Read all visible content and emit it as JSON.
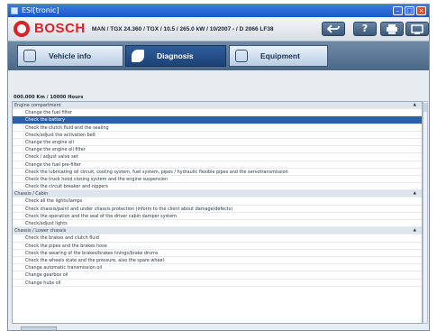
{
  "window": {
    "title": "ESI[tronic]",
    "min_label": "–",
    "max_label": "□",
    "close_label": "×"
  },
  "header": {
    "brand": "BOSCH",
    "vehicle": "MAN / TGX 24.360 / TGX / 10.5 / 265.0 kW / 10/2007 - / D 2066 LF38",
    "help_label": "?"
  },
  "tabs": [
    {
      "label": "Vehicle info"
    },
    {
      "label": "Diagnosis"
    },
    {
      "label": "Equipment"
    }
  ],
  "summary": "000.000 Km / 10000 Hours",
  "list": {
    "cat_engine": "Engine compartment",
    "engine": [
      "Change the fuel filter",
      "Check the battery",
      "Check the clutch fluid and the sealing",
      "Check/adjust the activation belt",
      "Change the engine oil",
      "Change the engine oil filter",
      "Check / adjust valve set",
      "Change the fuel pre-filter",
      "Check the lubricating oil circuit, cooling system, fuel system, pipes / hydraulic flexible pipes and the servotransmission",
      "Check the truck hood closing system and the engine suspension",
      "Check the circuit breaker and nippers"
    ],
    "cat_chassis_cabin": "Chassis / Cabin",
    "chassis_cabin": [
      "Check all the lights/lamps",
      "Check chassis/paint and under chassis protection (inform to the client about damage/defects)",
      "Check the operation and the seal of the driver cabin damper system",
      "Check/adjust lights"
    ],
    "cat_chassis_lower": "Chassis / Lower chassis",
    "chassis_lower": [
      "Check the brakes and clutch fluid",
      "Check the pipes and the brakes hose",
      "Check the wearing of the brakes/brakes linings/brake drums",
      "Check the wheels state and the pressure, also the spare wheel",
      "Change automatic transmission oil",
      "Change gearbox oil",
      "Change hubs oil"
    ]
  }
}
